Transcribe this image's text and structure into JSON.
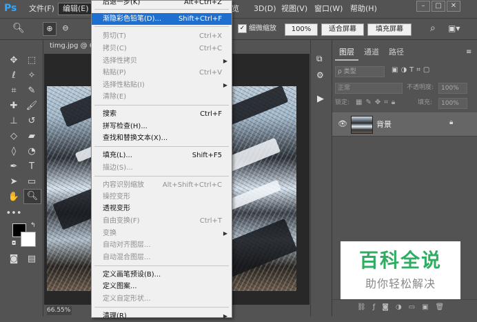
{
  "app": {
    "logo": "Ps",
    "doc_tab": "timg.jpg @ 6",
    "zoom_status": "66.55%"
  },
  "menubar": {
    "items": [
      "文件(F)",
      "编辑(E)",
      "览",
      "3D(D)",
      "视图(V)",
      "窗口(W)",
      "帮助(H)"
    ],
    "window_buttons": [
      "–",
      "□",
      "✕"
    ]
  },
  "options": {
    "scrubby_label": "细微缩放",
    "zoom_100": "100%",
    "fit_screen": "适合屏幕",
    "fill_screen": "填充屏幕"
  },
  "menu": {
    "items": [
      {
        "label": "后退一步(K)",
        "shortcut": "Alt+Ctrl+Z",
        "disabled": false
      },
      {
        "label": "渐隐彩色铅笔(D)...",
        "shortcut": "Shift+Ctrl+F",
        "highlighted": true
      },
      {
        "label": "剪切(T)",
        "shortcut": "Ctrl+X",
        "disabled": true
      },
      {
        "label": "拷贝(C)",
        "shortcut": "Ctrl+C",
        "disabled": true
      },
      {
        "label": "选择性拷贝",
        "shortcut": "",
        "disabled": true,
        "submenu": true
      },
      {
        "label": "粘贴(P)",
        "shortcut": "Ctrl+V",
        "disabled": true
      },
      {
        "label": "选择性粘贴(I)",
        "shortcut": "",
        "disabled": true,
        "submenu": true
      },
      {
        "label": "清除(E)",
        "shortcut": "",
        "disabled": true
      },
      {
        "label": "搜索",
        "shortcut": "Ctrl+F",
        "disabled": false
      },
      {
        "label": "拼写检查(H)...",
        "shortcut": "",
        "disabled": false
      },
      {
        "label": "查找和替换文本(X)...",
        "shortcut": "",
        "disabled": false
      },
      {
        "label": "填充(L)...",
        "shortcut": "Shift+F5",
        "disabled": false
      },
      {
        "label": "描边(S)...",
        "shortcut": "",
        "disabled": true
      },
      {
        "label": "内容识别缩放",
        "shortcut": "Alt+Shift+Ctrl+C",
        "disabled": true
      },
      {
        "label": "操控变形",
        "shortcut": "",
        "disabled": true
      },
      {
        "label": "透视变形",
        "shortcut": "",
        "disabled": false
      },
      {
        "label": "自由变换(F)",
        "shortcut": "Ctrl+T",
        "disabled": true
      },
      {
        "label": "变换",
        "shortcut": "",
        "disabled": true,
        "submenu": true
      },
      {
        "label": "自动对齐图层...",
        "shortcut": "",
        "disabled": true
      },
      {
        "label": "自动混合图层...",
        "shortcut": "",
        "disabled": true
      },
      {
        "label": "定义画笔预设(B)...",
        "shortcut": "",
        "disabled": false
      },
      {
        "label": "定义图案...",
        "shortcut": "",
        "disabled": false
      },
      {
        "label": "定义自定形状...",
        "shortcut": "",
        "disabled": true
      },
      {
        "label": "清理(R)",
        "shortcut": "",
        "disabled": false,
        "submenu": true
      }
    ]
  },
  "layers_panel": {
    "tabs": [
      "图层",
      "通道",
      "路径"
    ],
    "filter_kind": "ρ 类型",
    "blend_mode": "正常",
    "opacity_label": "不透明度:",
    "opacity_value": "100%",
    "lock_label": "锁定:",
    "fill_label": "填充:",
    "fill_value": "100%",
    "layer_name": "背景"
  },
  "watermark": {
    "title": "百科全说",
    "subtitle": "助你轻松解决"
  }
}
